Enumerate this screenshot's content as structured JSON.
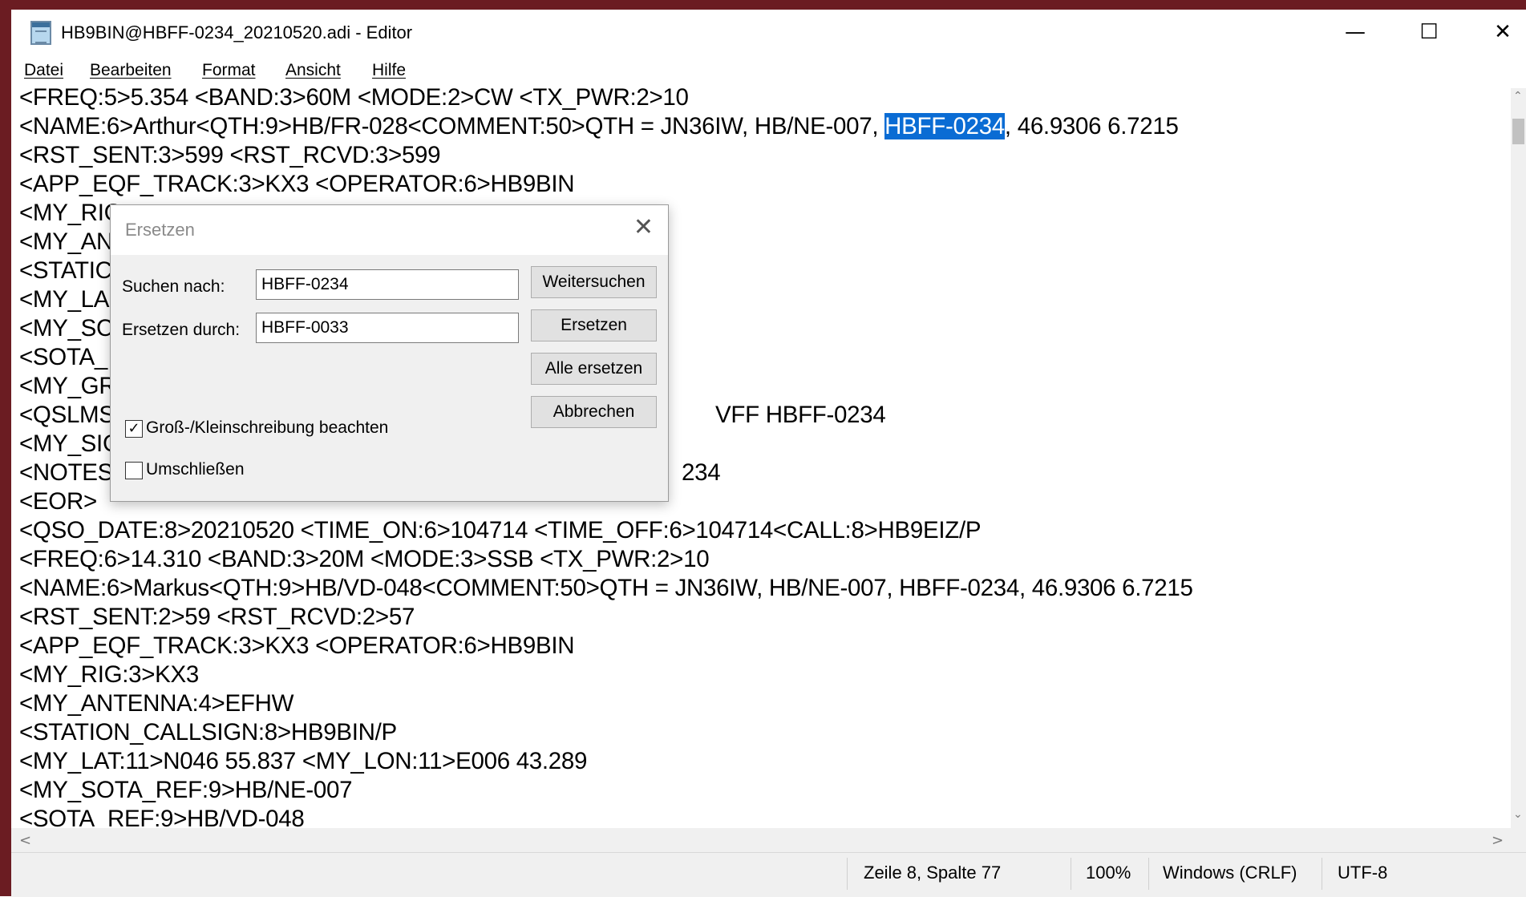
{
  "window": {
    "title": "HB9BIN@HBFF-0234_20210520.adi - Editor",
    "minimize": "—",
    "maximize": "☐",
    "close": "✕"
  },
  "menu": [
    "Datei",
    "Bearbeiten",
    "Format",
    "Ansicht",
    "Hilfe"
  ],
  "editor": {
    "lines": [
      "<FREQ:5>5.354 <BAND:3>60M <MODE:2>CW <TX_PWR:2>10",
      "<NAME:6>Arthur<QTH:9>HB/FR-028<COMMENT:50>QTH = JN36IW, HB/NE-007, ",
      "<RST_SENT:3>599 <RST_RCVD:3>599",
      "<APP_EQF_TRACK:3>KX3 <OPERATOR:6>HB9BIN",
      "<MY_RIG",
      "<MY_AN",
      "<STATIC",
      "<MY_LA",
      "<MY_SC",
      "<SOTA_",
      "<MY_GR",
      "<QSLMS",
      "<MY_SIG",
      "<NOTES",
      "<EOR>",
      "<QSO_DATE:8>20210520 <TIME_ON:6>104714 <TIME_OFF:6>104714<CALL:8>HB9EIZ/P",
      "<FREQ:6>14.310 <BAND:3>20M <MODE:3>SSB <TX_PWR:2>10",
      "<NAME:6>Markus<QTH:9>HB/VD-048<COMMENT:50>QTH = JN36IW, HB/NE-007, HBFF-0234, 46.9306 6.7215",
      "<RST_SENT:2>59 <RST_RCVD:2>57",
      "<APP_EQF_TRACK:3>KX3 <OPERATOR:6>HB9BIN",
      "<MY_RIG:3>KX3",
      "<MY_ANTENNA:4>EFHW",
      "<STATION_CALLSIGN:8>HB9BIN/P",
      "<MY_LAT:11>N046 55.837 <MY_LON:11>E006 43.289",
      "<MY_SOTA_REF:9>HB/NE-007",
      "<SOTA_REF:9>HB/VD-048"
    ],
    "selection": "HBFF-0234",
    "line2_after": ", 46.9306 6.7215",
    "line12_tail": "VFF HBFF-0234",
    "line14_tail": "234"
  },
  "dialog": {
    "title": "Ersetzen",
    "close": "✕",
    "find_label": "Suchen nach:",
    "find_value": "HBFF-0234",
    "replace_label": "Ersetzen durch:",
    "replace_value": "HBFF-0033",
    "buttons": {
      "find_next": "Weitersuchen",
      "replace": "Ersetzen",
      "replace_all": "Alle ersetzen",
      "cancel": "Abbrechen"
    },
    "match_case_label": "Groß-/Kleinschreibung beachten",
    "match_case_checked": true,
    "wrap_label": "Umschließen",
    "wrap_checked": false,
    "checkmark": "✓"
  },
  "status": {
    "position": "Zeile 8, Spalte 77",
    "zoom": "100%",
    "line_ending": "Windows (CRLF)",
    "encoding": "UTF-8"
  },
  "scroll": {
    "up": "⌃",
    "down": "⌄",
    "left": "<",
    "right": ">"
  }
}
